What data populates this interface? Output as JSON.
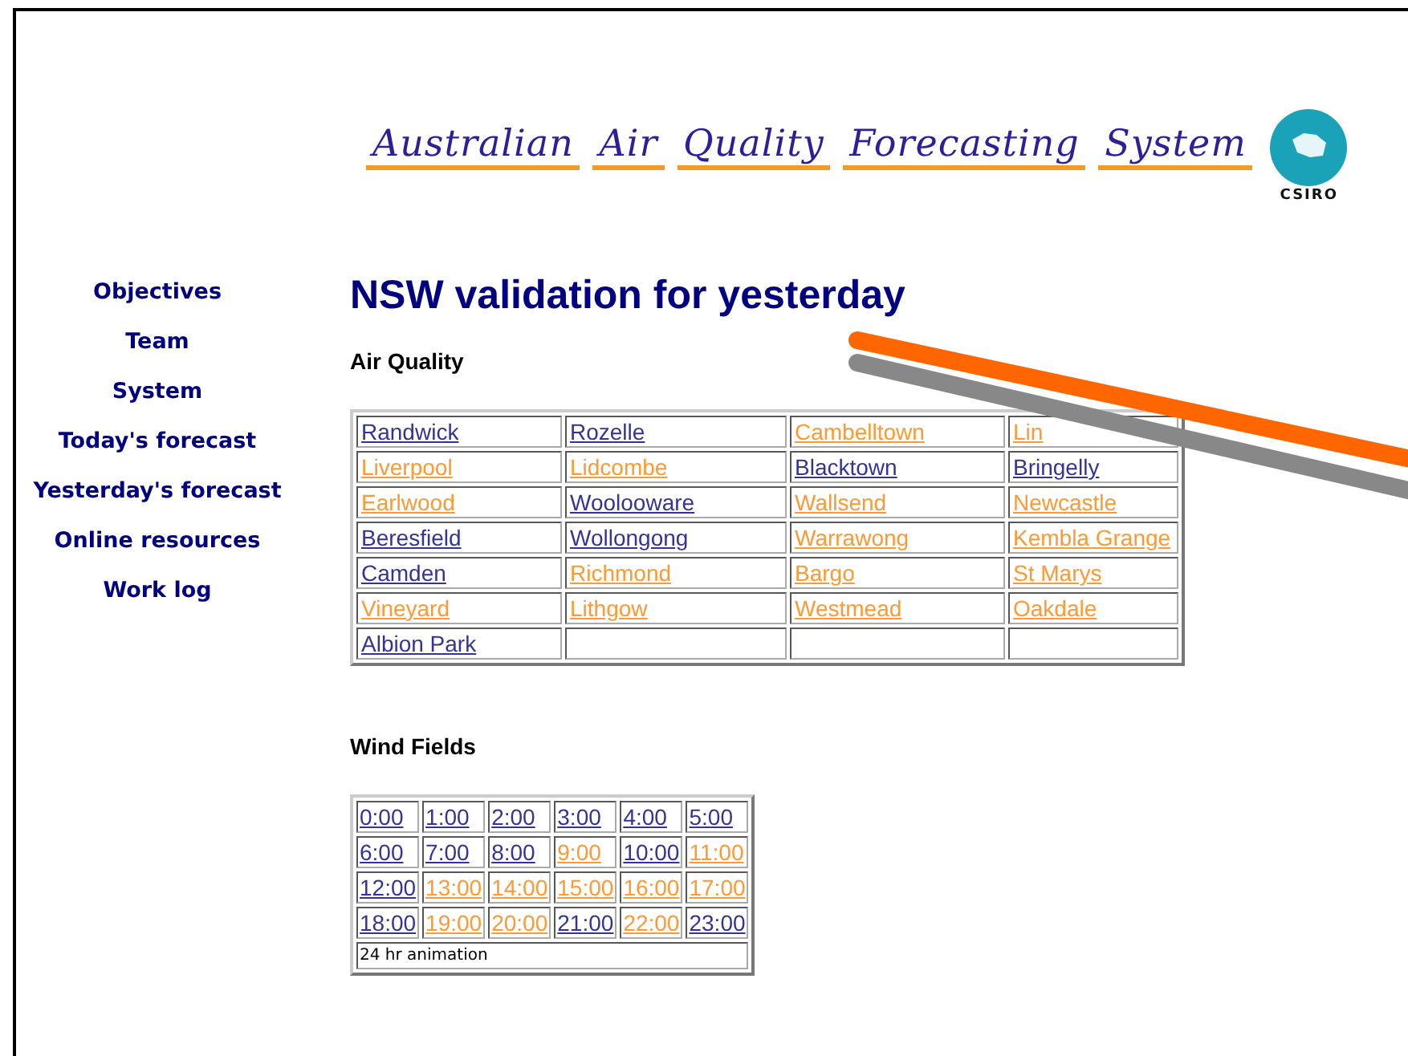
{
  "banner": {
    "title_words": [
      "Australian",
      "Air",
      "Quality",
      "Forecasting",
      "System"
    ],
    "org": "CSIRO"
  },
  "sidebar": {
    "items": [
      {
        "label": "Objectives"
      },
      {
        "label": "Team"
      },
      {
        "label": "System"
      },
      {
        "label": "Today's forecast"
      },
      {
        "label": "Yesterday's forecast"
      },
      {
        "label": "Online resources"
      },
      {
        "label": "Work log"
      }
    ]
  },
  "heading": "NSW validation for yesterday",
  "air_quality": {
    "title": "Air Quality",
    "rows": [
      [
        {
          "label": "Randwick",
          "visited": false
        },
        {
          "label": "Rozelle",
          "visited": false
        },
        {
          "label": "Cambelltown",
          "visited": true
        },
        {
          "label": "Lin",
          "visited": true
        }
      ],
      [
        {
          "label": "Liverpool",
          "visited": true
        },
        {
          "label": "Lidcombe",
          "visited": true
        },
        {
          "label": "Blacktown",
          "visited": false
        },
        {
          "label": "Bringelly",
          "visited": false
        }
      ],
      [
        {
          "label": "Earlwood",
          "visited": true
        },
        {
          "label": "Woolooware",
          "visited": false
        },
        {
          "label": "Wallsend",
          "visited": true
        },
        {
          "label": "Newcastle",
          "visited": true
        }
      ],
      [
        {
          "label": "Beresfield",
          "visited": false
        },
        {
          "label": "Wollongong",
          "visited": false
        },
        {
          "label": "Warrawong",
          "visited": true
        },
        {
          "label": "Kembla Grange",
          "visited": true
        }
      ],
      [
        {
          "label": "Camden",
          "visited": false
        },
        {
          "label": "Richmond",
          "visited": true
        },
        {
          "label": "Bargo",
          "visited": true
        },
        {
          "label": "St Marys",
          "visited": true
        }
      ],
      [
        {
          "label": "Vineyard",
          "visited": true
        },
        {
          "label": "Lithgow",
          "visited": true
        },
        {
          "label": "Westmead",
          "visited": true
        },
        {
          "label": "Oakdale",
          "visited": true
        }
      ],
      [
        {
          "label": "Albion Park",
          "visited": false
        },
        null,
        null,
        null
      ]
    ]
  },
  "wind_fields": {
    "title": "Wind Fields",
    "rows": [
      [
        {
          "label": "0:00",
          "visited": false
        },
        {
          "label": "1:00",
          "visited": false
        },
        {
          "label": "2:00",
          "visited": false
        },
        {
          "label": "3:00",
          "visited": false
        },
        {
          "label": "4:00",
          "visited": false
        },
        {
          "label": "5:00",
          "visited": false
        }
      ],
      [
        {
          "label": "6:00",
          "visited": false
        },
        {
          "label": "7:00",
          "visited": false
        },
        {
          "label": "8:00",
          "visited": false
        },
        {
          "label": "9:00",
          "visited": true
        },
        {
          "label": "10:00",
          "visited": false
        },
        {
          "label": "11:00",
          "visited": true
        }
      ],
      [
        {
          "label": "12:00",
          "visited": false
        },
        {
          "label": "13:00",
          "visited": true
        },
        {
          "label": "14:00",
          "visited": true
        },
        {
          "label": "15:00",
          "visited": true
        },
        {
          "label": "16:00",
          "visited": true
        },
        {
          "label": "17:00",
          "visited": true
        }
      ],
      [
        {
          "label": "18:00",
          "visited": false
        },
        {
          "label": "19:00",
          "visited": true
        },
        {
          "label": "20:00",
          "visited": true
        },
        {
          "label": "21:00",
          "visited": false
        },
        {
          "label": "22:00",
          "visited": true
        },
        {
          "label": "23:00",
          "visited": false
        }
      ]
    ],
    "footer": "24 hr animation"
  }
}
